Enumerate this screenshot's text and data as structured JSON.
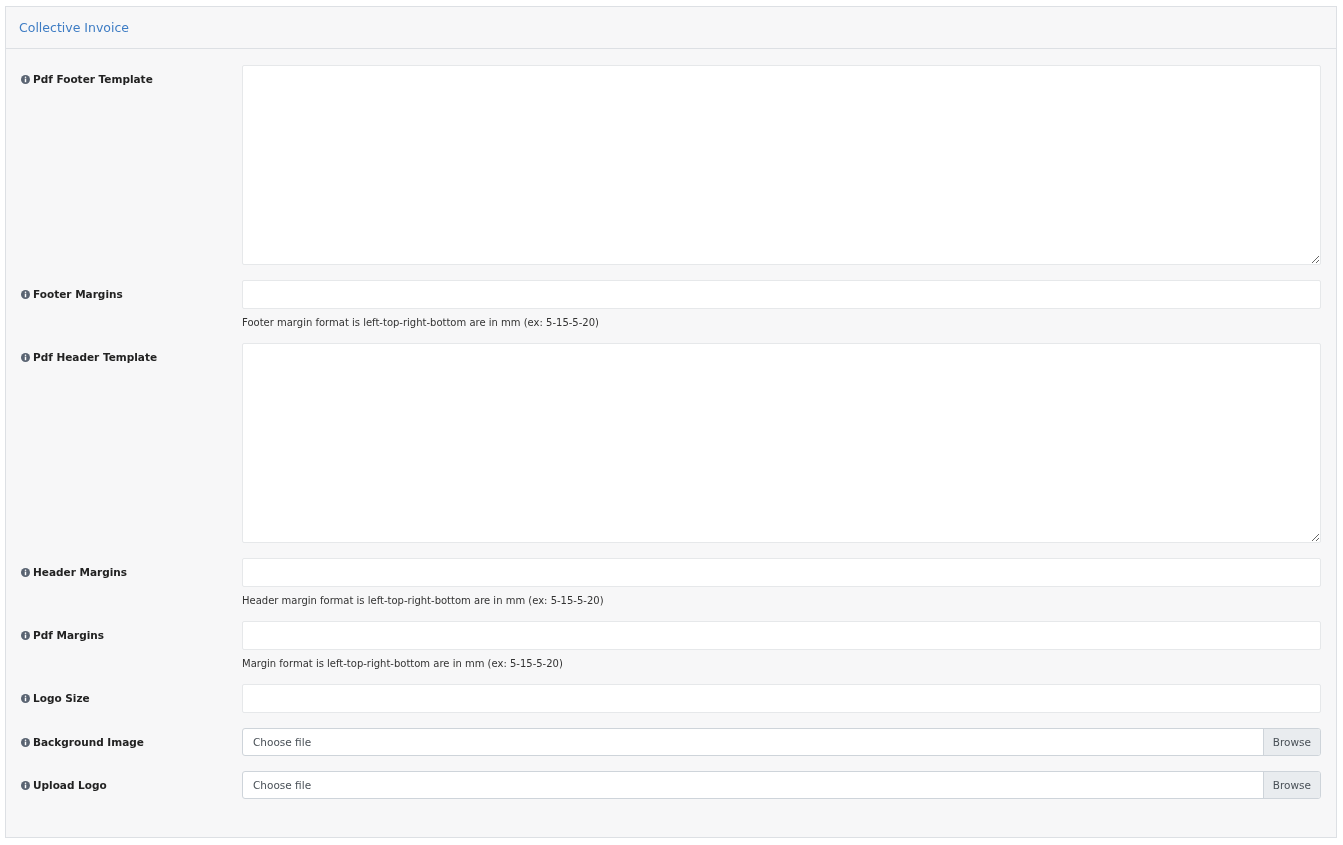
{
  "panel": {
    "title": "Collective Invoice"
  },
  "fields": [
    {
      "kind": "textarea",
      "label": "Pdf Footer Template"
    },
    {
      "kind": "text",
      "label": "Footer Margins",
      "help": "Footer margin format is left-top-right-bottom are in mm (ex: 5-15-5-20)"
    },
    {
      "kind": "textarea",
      "label": "Pdf Header Template"
    },
    {
      "kind": "text",
      "label": "Header Margins",
      "help": "Header margin format is left-top-right-bottom are in mm (ex: 5-15-5-20)"
    },
    {
      "kind": "text",
      "label": "Pdf Margins",
      "help": "Margin format is left-top-right-bottom are in mm (ex: 5-15-5-20)"
    },
    {
      "kind": "text",
      "label": "Logo Size"
    },
    {
      "kind": "file",
      "label": "Background Image",
      "file_text": "Choose file",
      "button": "Browse"
    },
    {
      "kind": "file",
      "label": "Upload Logo",
      "file_text": "Choose file",
      "button": "Browse"
    }
  ]
}
